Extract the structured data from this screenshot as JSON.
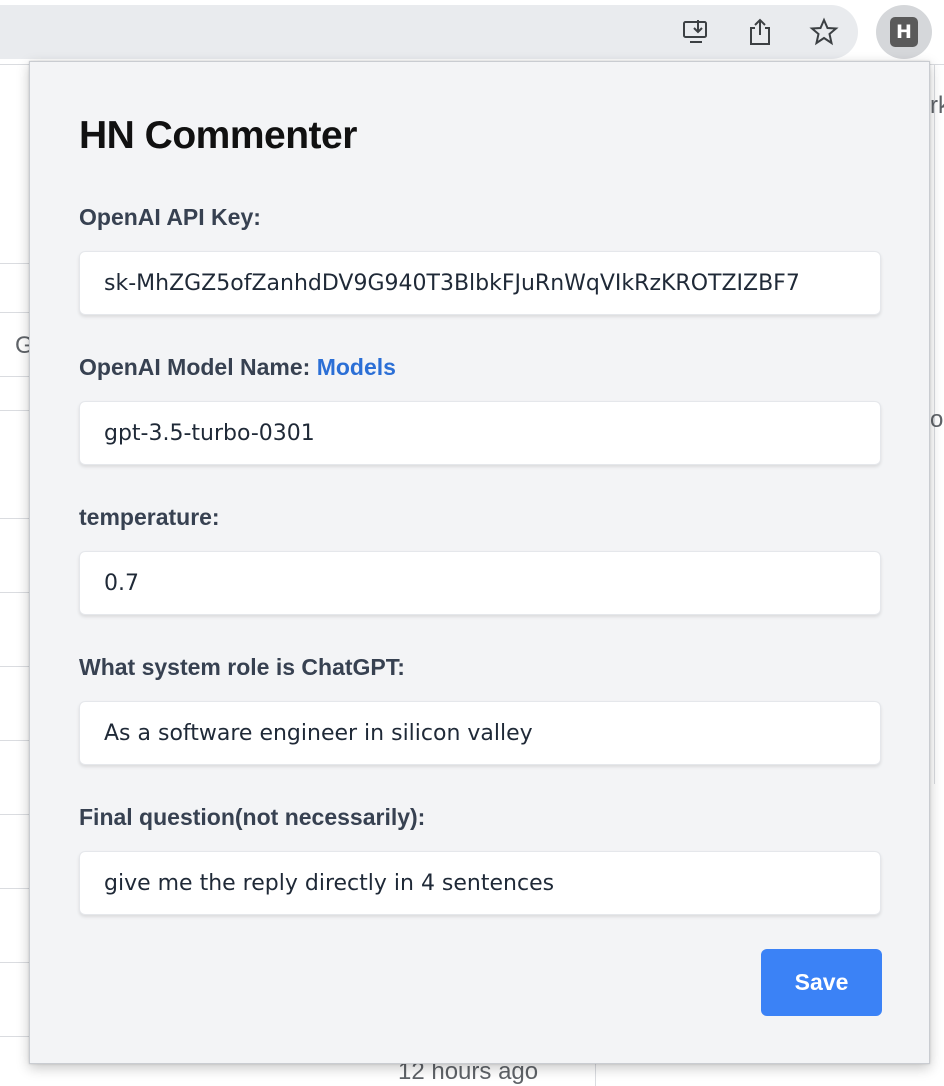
{
  "browser": {
    "toolbar_icons": [
      "install-app-icon",
      "share-icon",
      "bookmark-star-icon"
    ],
    "extension_badge": "H"
  },
  "background_page": {
    "fragment_top_right": "rk",
    "fragment_left": "G",
    "fragment_right": "os",
    "footer_time": "12 hours ago"
  },
  "popup": {
    "title": "HN Commenter",
    "api_key": {
      "label": "OpenAI API Key:",
      "value": "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"
    },
    "model": {
      "label": "OpenAI Model Name:",
      "link": "Models",
      "value": "gpt-3.5-turbo-0301"
    },
    "temperature": {
      "label": "temperature:",
      "value": "0.7"
    },
    "system_role": {
      "label": "What system role is ChatGPT:",
      "value": "As a software engineer in silicon valley"
    },
    "final_question": {
      "label": "Final question(not necessarily):",
      "value": "give me the reply directly in 4 sentences"
    },
    "save_label": "Save"
  },
  "colors": {
    "accent": "#3b82f6",
    "link": "#2b6fd6",
    "popup_bg": "#f3f4f6"
  }
}
